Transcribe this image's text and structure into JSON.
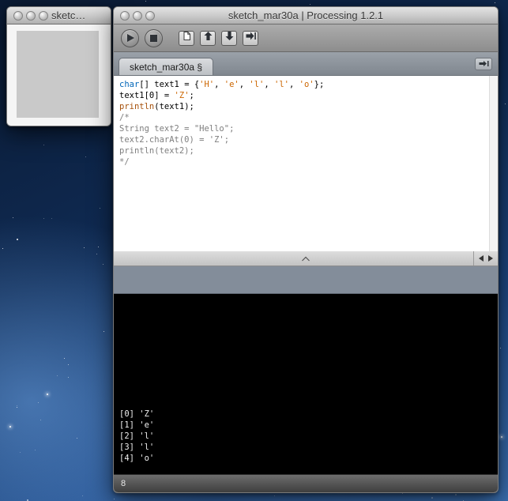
{
  "sketch_window": {
    "title": "sketc…"
  },
  "ide_window": {
    "title": "sketch_mar30a | Processing 1.2.1",
    "toolbar": {
      "buttons": [
        {
          "name": "run",
          "icon": "play-icon"
        },
        {
          "name": "stop",
          "icon": "stop-icon"
        },
        {
          "name": "new",
          "icon": "new-sketch-icon"
        },
        {
          "name": "open",
          "icon": "open-icon"
        },
        {
          "name": "save",
          "icon": "save-icon"
        },
        {
          "name": "export",
          "icon": "export-icon"
        }
      ]
    },
    "tab_label": "sketch_mar30a §",
    "editor": {
      "lines": [
        [
          [
            "kw",
            "char"
          ],
          [
            "pl",
            "[] text1 = {"
          ],
          [
            "str",
            "'H'"
          ],
          [
            "pl",
            ", "
          ],
          [
            "str",
            "'e'"
          ],
          [
            "pl",
            ", "
          ],
          [
            "str",
            "'l'"
          ],
          [
            "pl",
            ", "
          ],
          [
            "str",
            "'l'"
          ],
          [
            "pl",
            ", "
          ],
          [
            "str",
            "'o'"
          ],
          [
            "pl",
            "};"
          ]
        ],
        [
          [
            "pl",
            "text1[0] = "
          ],
          [
            "str",
            "'Z'"
          ],
          [
            "pl",
            ";"
          ]
        ],
        [
          [
            "fn",
            "println"
          ],
          [
            "pl",
            "(text1);"
          ]
        ],
        [
          [
            "cm",
            "/*"
          ]
        ],
        [
          [
            "cm",
            "String text2 = \"Hello\";"
          ]
        ],
        [
          [
            "cm",
            "text2.charAt(0) = 'Z';"
          ]
        ],
        [
          [
            "cm",
            "println(text2);"
          ]
        ],
        [
          [
            "cm",
            "*/"
          ]
        ]
      ]
    },
    "console_lines": [
      "[0] 'Z'",
      "[1] 'e'",
      "[2] 'l'",
      "[3] 'l'",
      "[4] 'o'"
    ],
    "status_line": "8"
  },
  "colors": {
    "keyword": "#0066B8",
    "literal": "#CC6600",
    "function": "#A6500A",
    "comment": "#7E7E7E",
    "console_bg": "#000000",
    "message_area": "#838D9A"
  }
}
